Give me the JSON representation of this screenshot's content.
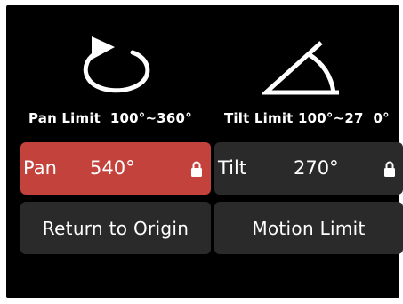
{
  "pan": {
    "icon": "pan-rotate-icon",
    "limit_label": "Pan Limit  100°~360°",
    "tile_label": "Pan",
    "tile_value": "540°",
    "locked": true,
    "tile_color": "#c3423c"
  },
  "tilt": {
    "icon": "tilt-angle-icon",
    "limit_label": "Tilt Limit 100°~27  0°",
    "tile_label": "Tilt",
    "tile_value": "270°",
    "locked": true,
    "tile_color": "#2a2a2a"
  },
  "buttons": {
    "return_to_origin": "Return to Origin",
    "motion_limit": "Motion Limit"
  },
  "colors": {
    "background": "#000000",
    "tile": "#2a2a2a",
    "accent": "#c3423c",
    "text": "#ffffff"
  }
}
